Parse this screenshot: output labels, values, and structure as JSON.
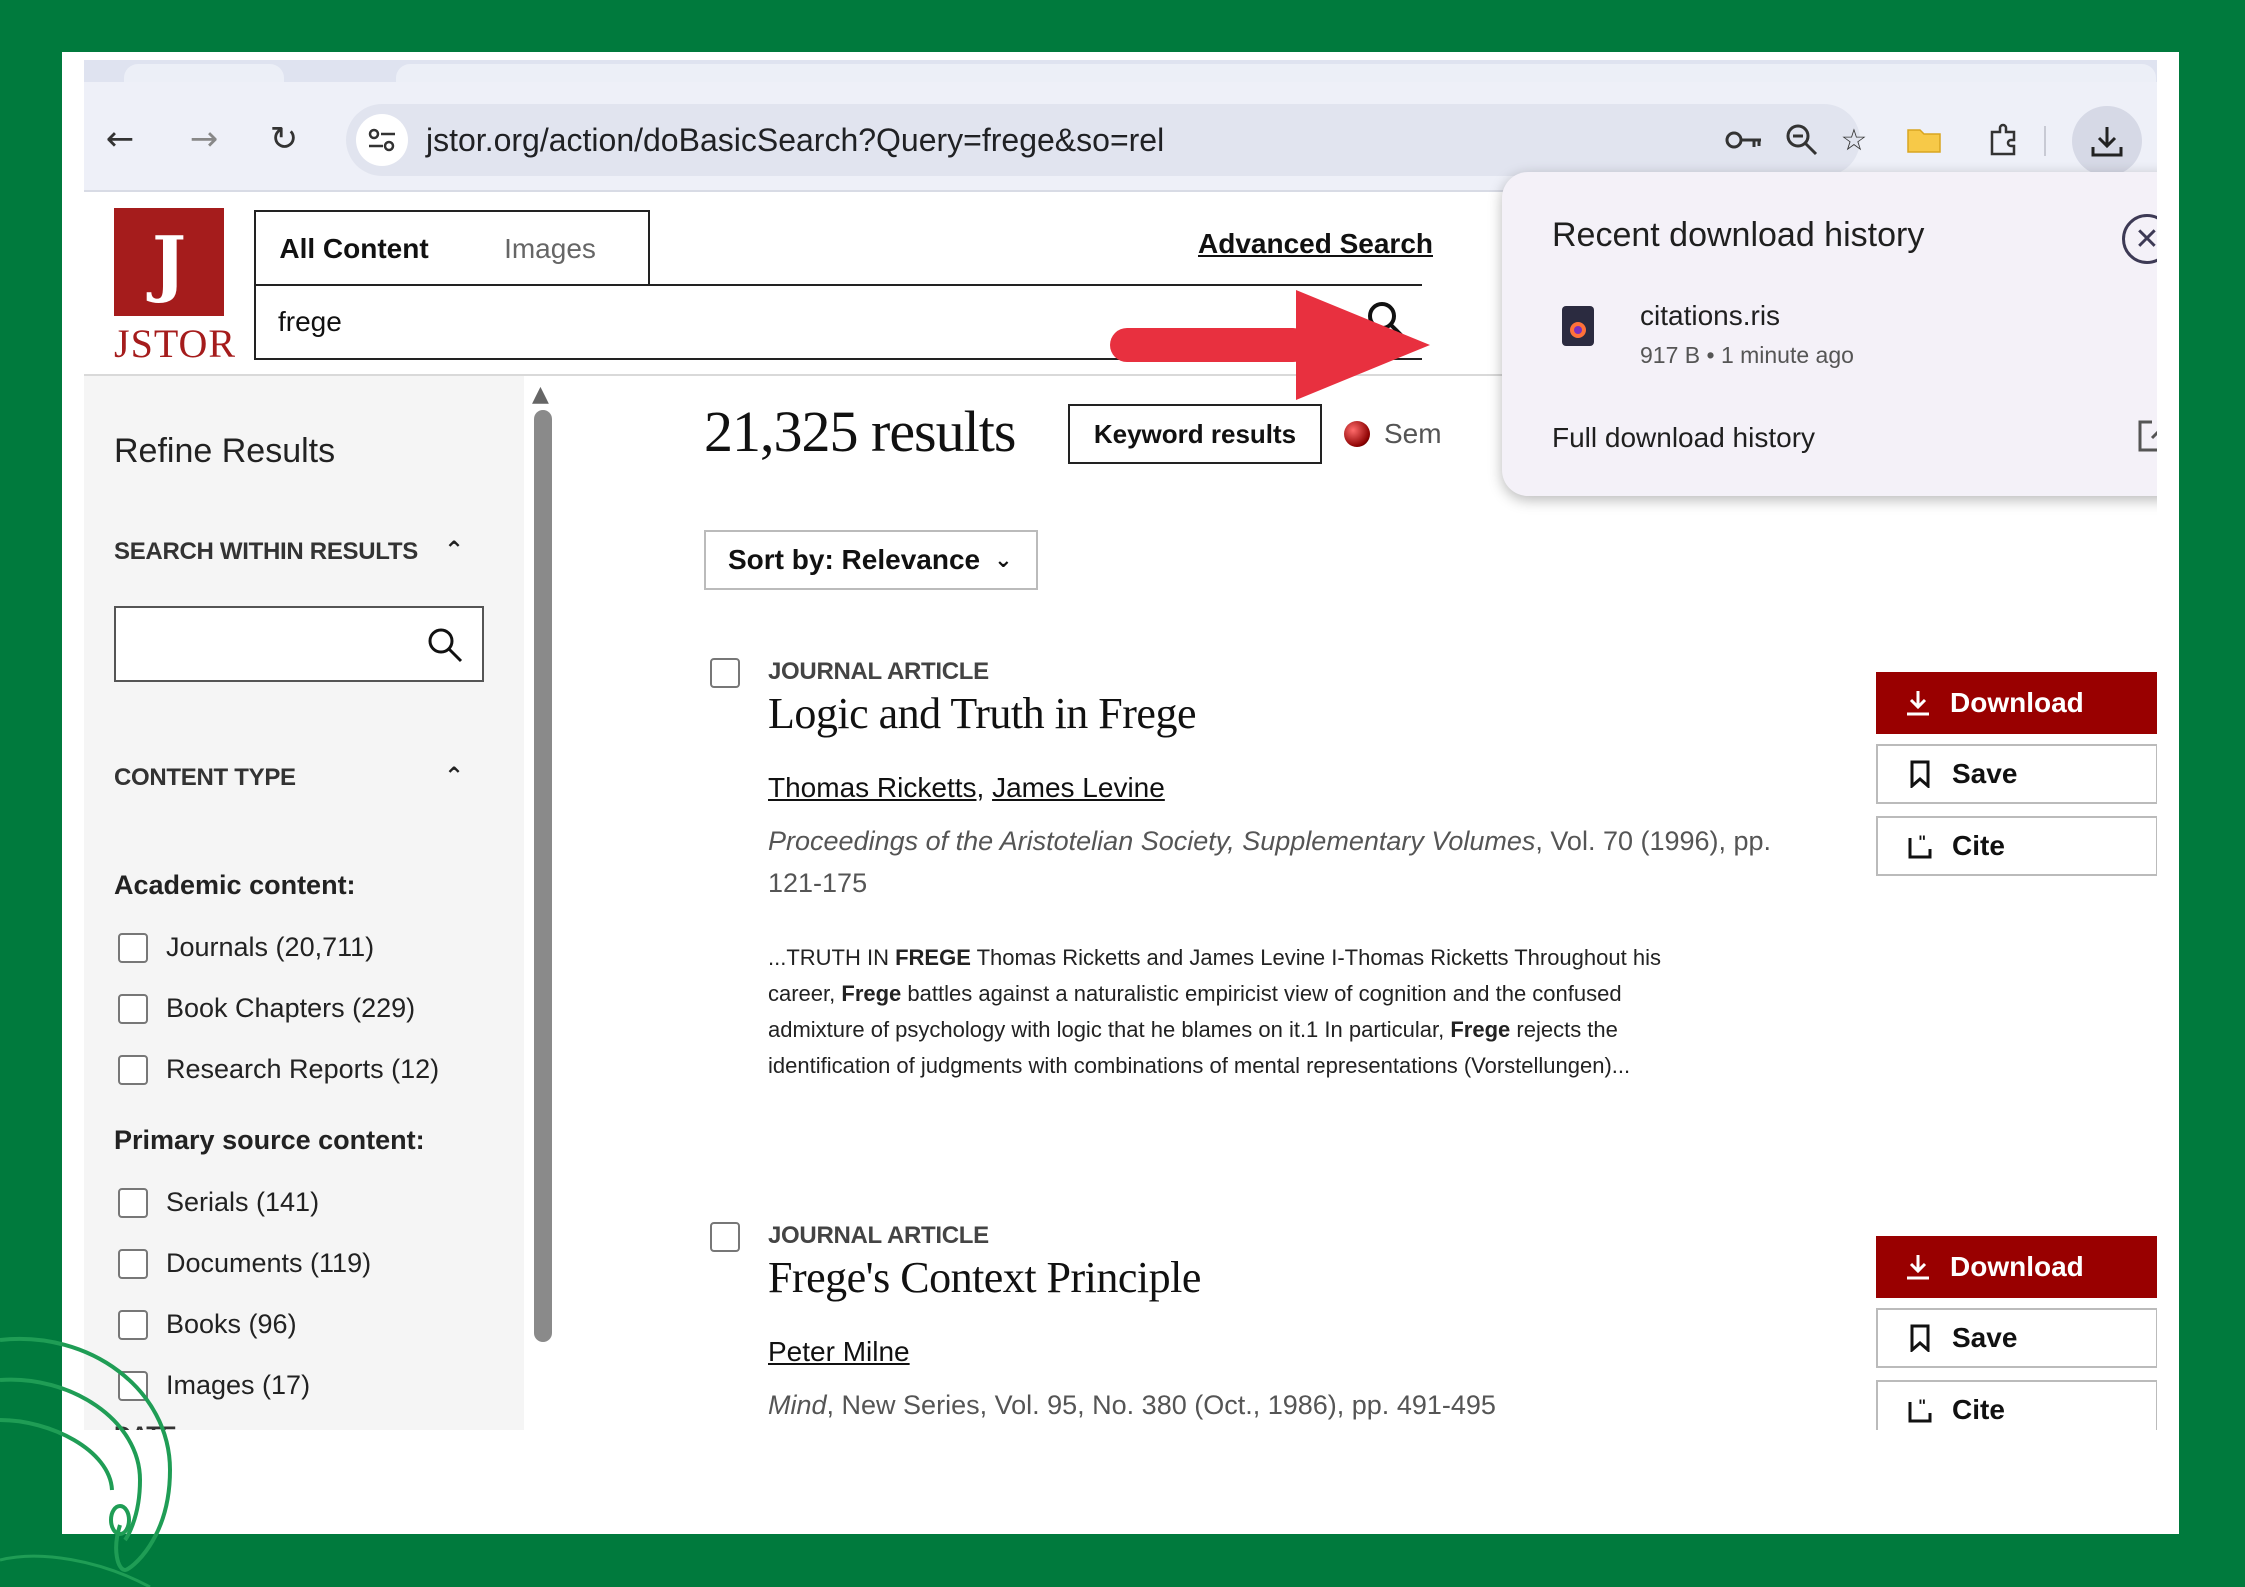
{
  "browser": {
    "url": "jstor.org/action/doBasicSearch?Query=frege&so=rel",
    "icons": [
      "back-icon",
      "forward-icon",
      "reload-icon",
      "tune-icon",
      "key-icon",
      "zoom-icon",
      "star-icon",
      "folder-icon",
      "extensions-icon",
      "download-icon"
    ]
  },
  "header": {
    "logo_text": "JSTOR",
    "tabs": [
      "All Content",
      "Images"
    ],
    "advanced_search": "Advanced Search",
    "search_value": "frege"
  },
  "sidebar": {
    "title": "Refine Results",
    "search_within": "SEARCH WITHIN RESULTS",
    "content_type": "CONTENT TYPE",
    "academic_label": "Academic content:",
    "academic_items": [
      "Journals (20,711)",
      "Book Chapters (229)",
      "Research Reports (12)"
    ],
    "primary_label": "Primary source content:",
    "primary_items": [
      "Serials (141)",
      "Documents (119)",
      "Books (96)",
      "Images (17)"
    ],
    "date_partial": "DATE"
  },
  "results": {
    "count": "21,325 results",
    "keyword_button": "Keyword results",
    "semantic_partial": "Sem",
    "sort_label": "Sort by: Relevance",
    "items": [
      {
        "type": "JOURNAL ARTICLE",
        "title": "Logic and Truth in Frege",
        "authors": [
          "Thomas Ricketts",
          "James Levine"
        ],
        "journal_italic": "Proceedings of the Aristotelian Society, Supplementary Volumes",
        "journal_rest": ", Vol. 70 (1996), pp. 121-175",
        "snippet": [
          {
            "t": "...TRUTH IN "
          },
          {
            "b": "FREGE"
          },
          {
            "t": " Thomas Ricketts and James Levine I-Thomas Ricketts Throughout his career, "
          },
          {
            "b": "Frege"
          },
          {
            "t": " battles against a naturalistic empiricist view of cognition and the confused admixture of psychology with logic that he blames on it.1 In particular, "
          },
          {
            "b": "Frege"
          },
          {
            "t": " rejects the identification of judgments with combinations of mental representations (Vorstellungen)..."
          }
        ]
      },
      {
        "type": "JOURNAL ARTICLE",
        "title": "Frege's Context Principle",
        "authors": [
          "Peter Milne"
        ],
        "journal_italic": "Mind",
        "journal_rest": ", New Series, Vol. 95, No. 380 (Oct., 1986), pp. 491-495"
      }
    ],
    "buttons": {
      "download": "Download",
      "save": "Save",
      "cite": "Cite"
    }
  },
  "download_popup": {
    "title": "Recent download history",
    "file_name": "citations.ris",
    "file_meta": "917 B • 1 minute ago",
    "full_history": "Full download history"
  },
  "colors": {
    "frame_green": "#007a3d",
    "jstor_red": "#990000",
    "arrow_red": "#e8303f"
  }
}
